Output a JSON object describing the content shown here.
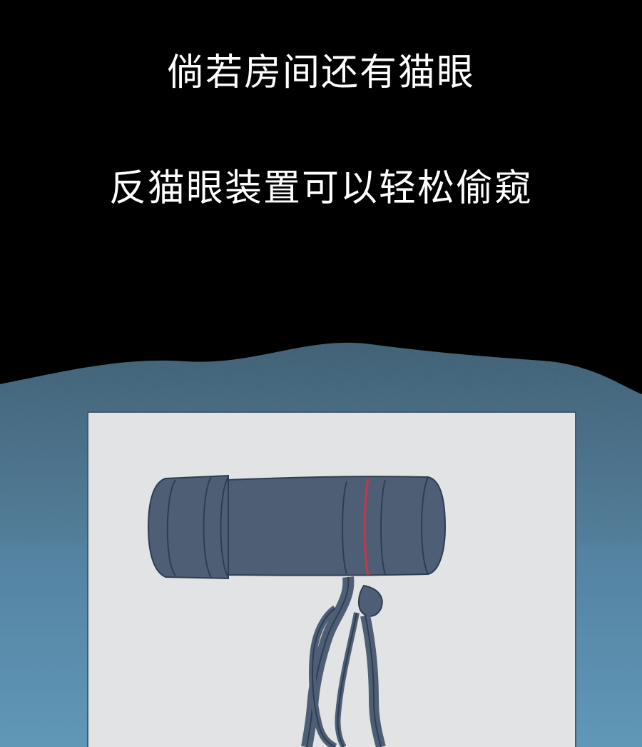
{
  "captions": {
    "line1": "倘若房间还有猫眼",
    "line2": "反猫眼装置可以轻松偷窥"
  },
  "colors": {
    "background": "#000000",
    "text": "#ffffff",
    "wave_top": "#3e5f74",
    "wave_bottom": "#5f93b3",
    "panel": "#e1e3e5",
    "panel_border": "#44596c",
    "device_body": "#4e5f75",
    "device_outline": "#2e3e52",
    "device_stripe": "#c8344a"
  },
  "icons": {
    "device": "monocular-telescope-icon",
    "strap": "wrist-strap-icon"
  }
}
